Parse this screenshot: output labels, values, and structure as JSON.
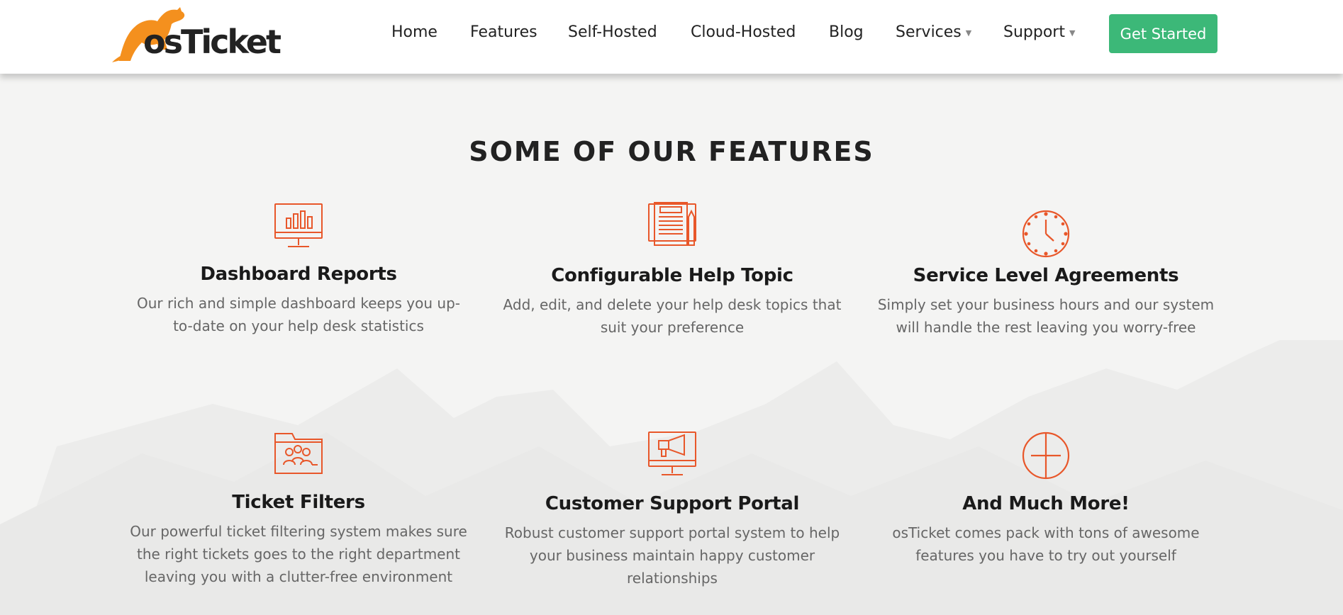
{
  "brand": {
    "name": "osTicket",
    "accent_orange": "#f4901e",
    "accent_green": "#3cb878",
    "icon_color": "#e8572a"
  },
  "nav": {
    "items": [
      {
        "label": "Home"
      },
      {
        "label": "Features"
      },
      {
        "label": "Self-Hosted"
      },
      {
        "label": "Cloud-Hosted"
      },
      {
        "label": "Blog"
      },
      {
        "label": "Services",
        "has_dropdown": true
      },
      {
        "label": "Support",
        "has_dropdown": true
      }
    ],
    "cta_label": "Get Started"
  },
  "section": {
    "title": "SOME OF OUR FEATURES"
  },
  "features": [
    {
      "icon": "dashboard-monitor-icon",
      "title": "Dashboard Reports",
      "text": "Our rich and simple dashboard keeps you up-to-date on your help desk statistics"
    },
    {
      "icon": "help-topic-document-icon",
      "title": "Configurable Help Topic",
      "text": "Add, edit, and delete your help desk topics that suit your preference"
    },
    {
      "icon": "clock-icon",
      "title": "Service Level Agreements",
      "text": "Simply set your business hours and our system will handle the rest leaving you worry-free"
    },
    {
      "icon": "folder-users-icon",
      "title": "Ticket Filters",
      "text": "Our powerful ticket filtering system makes sure the right tickets goes to the right department leaving you with a clutter-free environment"
    },
    {
      "icon": "megaphone-monitor-icon",
      "title": "Customer Support Portal",
      "text": "Robust customer support portal system to help your business maintain happy customer relationships"
    },
    {
      "icon": "crosshair-circle-icon",
      "title": "And Much More!",
      "text": "osTicket comes pack with tons of awesome features you have to try out yourself"
    }
  ]
}
